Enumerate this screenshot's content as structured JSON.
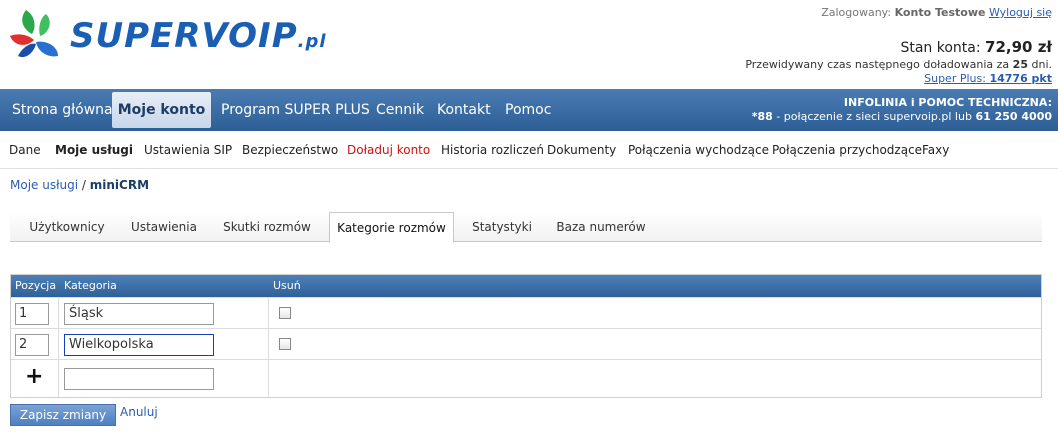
{
  "header": {
    "logo_text": "SUPERVOIP",
    "logo_suffix": ".pl",
    "logged_label": "Zalogowany:",
    "user_name": "Konto Testowe",
    "logout_label": "Wyloguj się",
    "balance_label": "Stan konta:",
    "balance_value": "72,90 zł",
    "forecast_prefix": "Przewidywany czas następnego doładowania za",
    "forecast_days": "25",
    "forecast_suffix": "dni.",
    "plus_label": "Super Plus:",
    "plus_value": "14776 pkt"
  },
  "mainnav": {
    "items": [
      "Strona główna",
      "Moje konto",
      "Program SUPER PLUS",
      "Cennik",
      "Kontakt",
      "Pomoc"
    ],
    "active_index": 1
  },
  "infolinia": {
    "title": "INFOLINIA i POMOC TECHNICZNA:",
    "short_number": "*88",
    "middle_text": "- połączenie z sieci supervoip.pl lub",
    "phone": "61 250 4000"
  },
  "subnav": {
    "items": [
      "Dane",
      "Moje usługi",
      "Ustawienia SIP",
      "Bezpieczeństwo",
      "Doładuj konto",
      "Historia rozliczeń",
      "Dokumenty",
      "Połączenia wychodzące",
      "Połączenia przychodzące",
      "Faxy"
    ]
  },
  "breadcrumb": {
    "parent": "Moje usługi",
    "separator": "/",
    "current": "miniCRM"
  },
  "tabs": {
    "items": [
      "Użytkownicy",
      "Ustawienia",
      "Skutki rozmów",
      "Kategorie rozmów",
      "Statystyki",
      "Baza numerów"
    ],
    "active_index": 3
  },
  "grid": {
    "headers": [
      "Pozycja",
      "Kategoria",
      "Usuń"
    ],
    "rows": [
      {
        "position": "1",
        "category": "Śląsk"
      },
      {
        "position": "2",
        "category": "Wielkopolska"
      }
    ],
    "new_row_position": "",
    "new_row_category": ""
  },
  "actions": {
    "save_label": "Zapisz zmiany",
    "cancel_label": "Anuluj"
  },
  "colors": {
    "nav_blue": "#2d5e96",
    "link_blue": "#2a5db0",
    "highlight_red": "#d01010"
  }
}
